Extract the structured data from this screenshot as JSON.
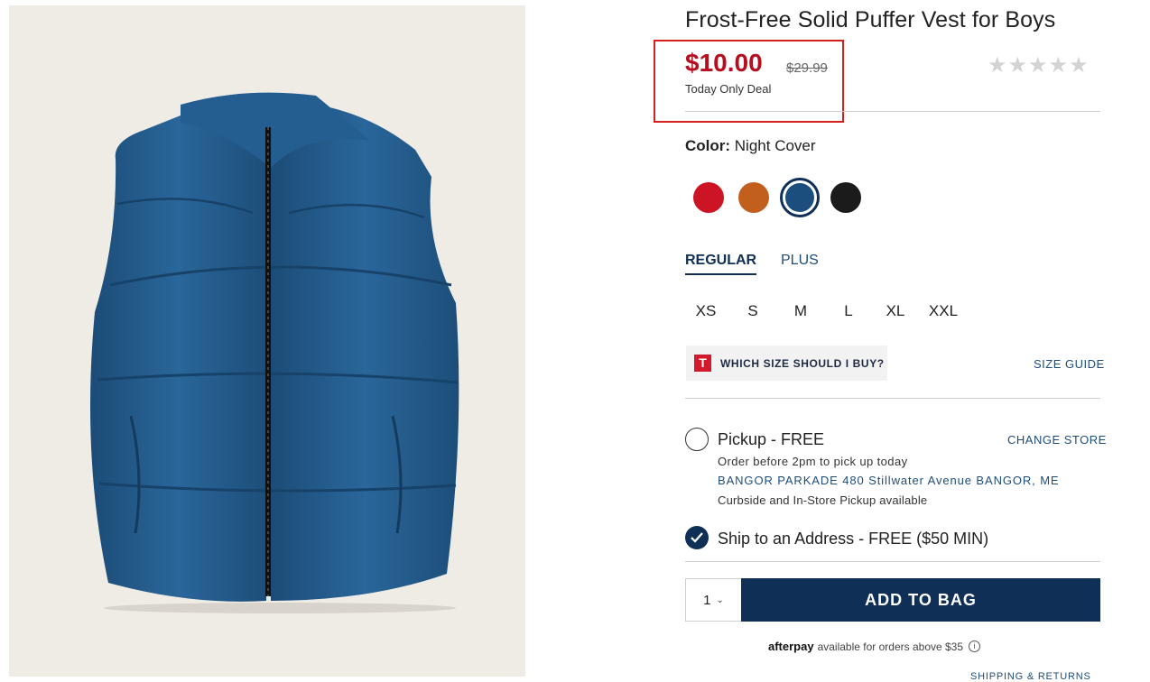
{
  "product": {
    "title": "Frost-Free Solid Puffer Vest for Boys",
    "price_now": "$10.00",
    "price_was": "$29.99",
    "deal_label": "Today Only Deal",
    "stars": "★★★★★",
    "rating_stars_filled": 0,
    "image_alt": "Blue puffer vest"
  },
  "color": {
    "label": "Color:",
    "value": "Night Cover",
    "swatches": [
      {
        "name": "red",
        "hex": "#cc1424"
      },
      {
        "name": "orange",
        "hex": "#c35f1d"
      },
      {
        "name": "night-cover",
        "hex": "#1b4e7c",
        "selected": true
      },
      {
        "name": "black",
        "hex": "#1b1b1b"
      }
    ]
  },
  "fit_tabs": [
    "REGULAR",
    "PLUS"
  ],
  "sizes": [
    "XS",
    "S",
    "M",
    "L",
    "XL",
    "XXL"
  ],
  "size_help": {
    "logo": "T",
    "label": "WHICH SIZE SHOULD I BUY?",
    "size_guide": "SIZE GUIDE"
  },
  "fulfillment": {
    "pickup_label": "Pickup - FREE",
    "change_store": "CHANGE STORE",
    "pickup_note": "Order before 2pm to pick up today",
    "store": "BANGOR PARKADE 480 Stillwater Avenue  BANGOR, ME",
    "curbside": "Curbside and In-Store Pickup available",
    "ship_label": "Ship to an Address - FREE ($50 MIN)"
  },
  "cart": {
    "quantity": "1",
    "add_to_bag": "ADD TO BAG"
  },
  "afterpay": {
    "logo": "afterpay",
    "text": "available for orders above $35",
    "info": "i"
  },
  "footer_link": "SHIPPING & RETURNS"
}
